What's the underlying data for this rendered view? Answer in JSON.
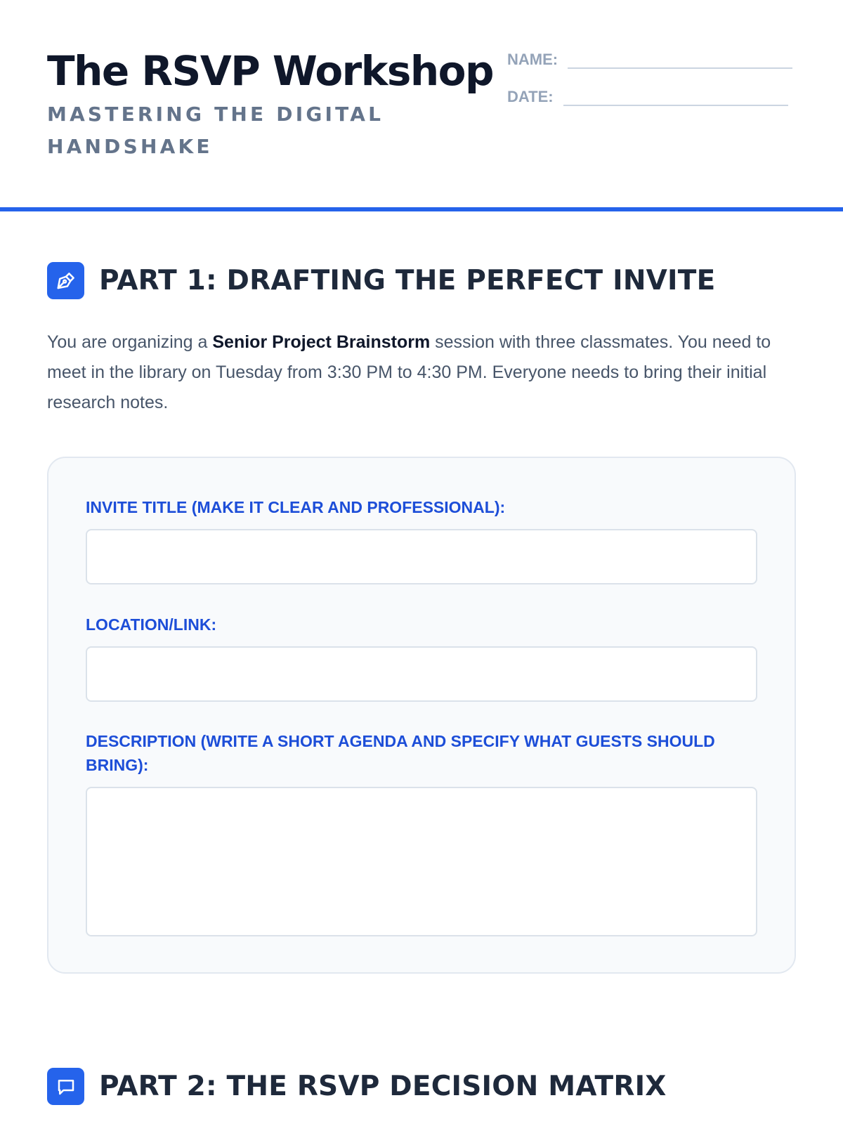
{
  "header": {
    "title": "The RSVP Workshop",
    "subtitle": "MASTERING THE DIGITAL HANDSHAKE",
    "name_label": "NAME:",
    "date_label": "DATE:"
  },
  "part1": {
    "icon": "pen-icon",
    "title": "PART 1: DRAFTING THE PERFECT INVITE",
    "intro_before": "You are organizing a ",
    "intro_bold": "Senior Project Brainstorm",
    "intro_after": " session with three classmates. You need to meet in the library on Tuesday from 3:30 PM to 4:30 PM. Everyone needs to bring their initial research notes.",
    "fields": {
      "invite_title_label": "INVITE TITLE (MAKE IT CLEAR AND PROFESSIONAL):",
      "invite_title_value": "",
      "location_label": "LOCATION/LINK:",
      "location_value": "",
      "description_label": "DESCRIPTION (WRITE A SHORT AGENDA AND SPECIFY WHAT GUESTS SHOULD BRING):",
      "description_value": ""
    }
  },
  "part2": {
    "icon": "chat-bubble-icon",
    "title": "PART 2: THE RSVP DECISION MATRIX"
  },
  "colors": {
    "accent": "#2563eb",
    "label": "#1d4ed8",
    "muted": "#64748b"
  }
}
